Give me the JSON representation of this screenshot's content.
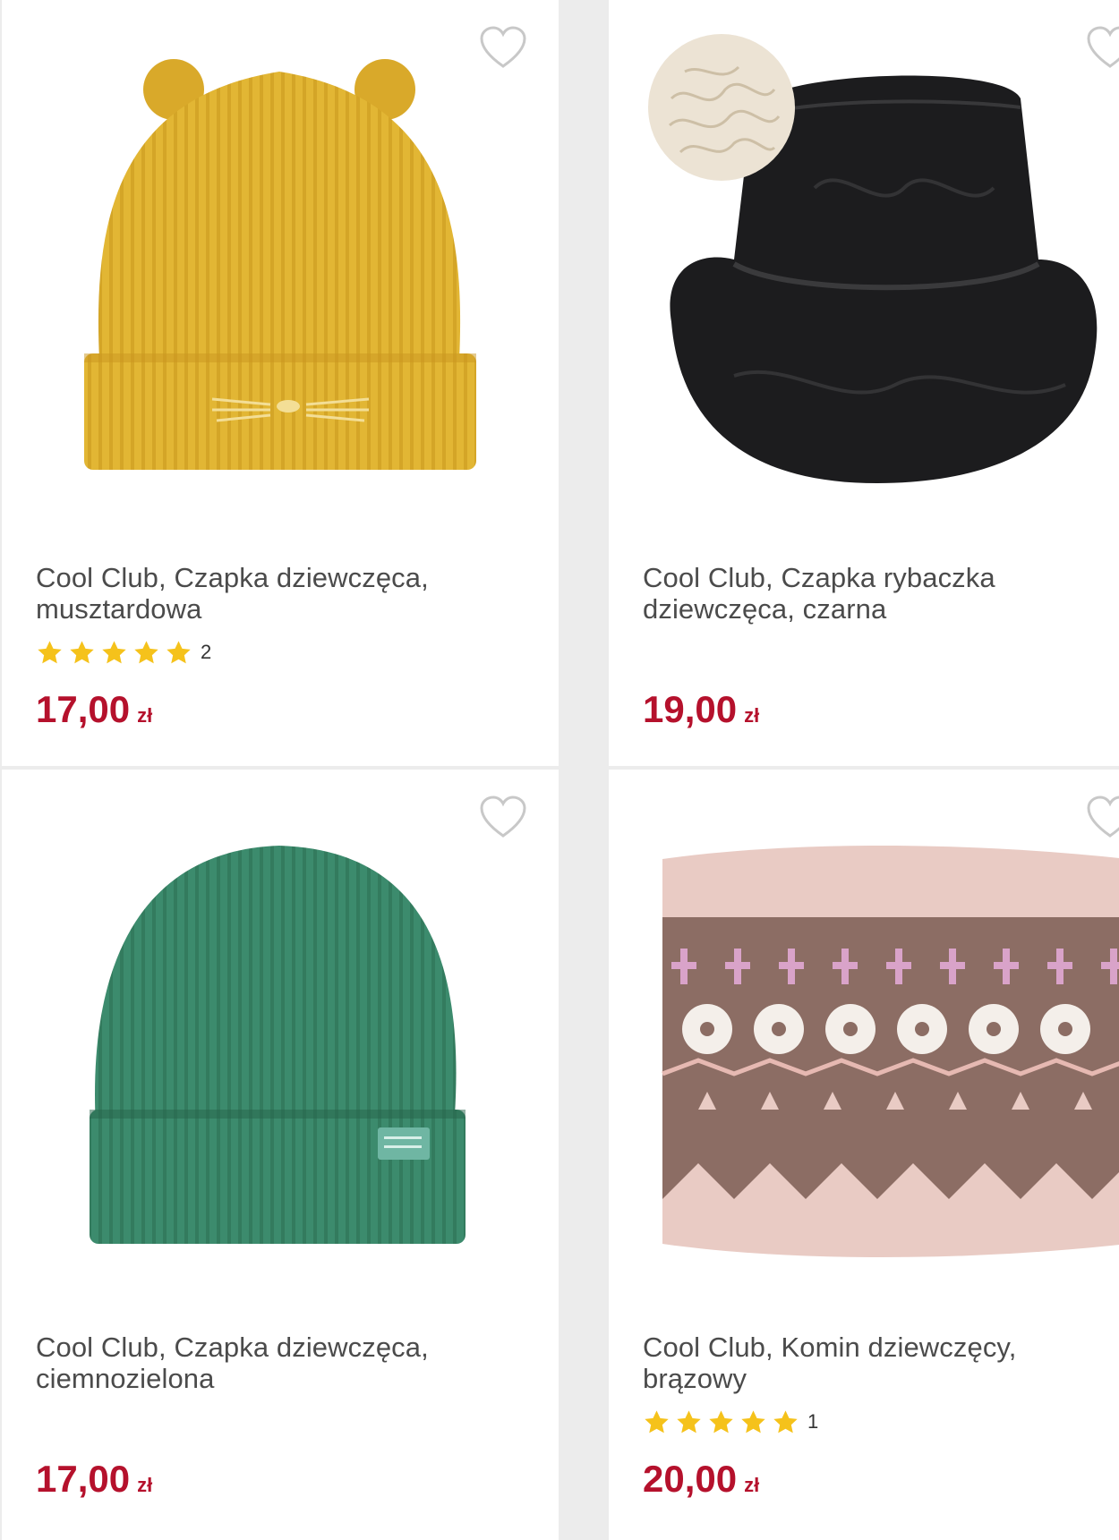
{
  "products": [
    {
      "title": "Cool Club, Czapka dziewczęca, musztardowa",
      "rating_stars": 5,
      "rating_count": "2",
      "price": "17,00",
      "currency": "zł",
      "image_icon": "mustard-cat-ear-beanie-image",
      "image_color": "#e2b634"
    },
    {
      "title": "Cool Club, Czapka rybaczka dziewczęca, czarna",
      "rating_stars": 0,
      "rating_count": "",
      "price": "19,00",
      "currency": "zł",
      "image_icon": "black-quilted-bucket-hat-image",
      "image_color": "#1d1d1f"
    },
    {
      "title": "Cool Club, Czapka dziewczęca, ciemnozielona",
      "rating_stars": 0,
      "rating_count": "",
      "price": "17,00",
      "currency": "zł",
      "image_icon": "dark-green-beanie-image",
      "image_color": "#3a8a6b"
    },
    {
      "title": "Cool Club, Komin dziewczęcy, brązowy",
      "rating_stars": 5,
      "rating_count": "1",
      "price": "20,00",
      "currency": "zł",
      "image_icon": "pink-brown-nordic-snood-image",
      "image_color": "#e8c8c1"
    }
  ],
  "colors": {
    "price": "#b5112c",
    "star": "#f5c21b",
    "heart_outline": "#c8c8c8",
    "title_text": "#4b4b4b"
  },
  "icons": {
    "favorite": "heart-outline-icon",
    "rating": "star-icon"
  }
}
